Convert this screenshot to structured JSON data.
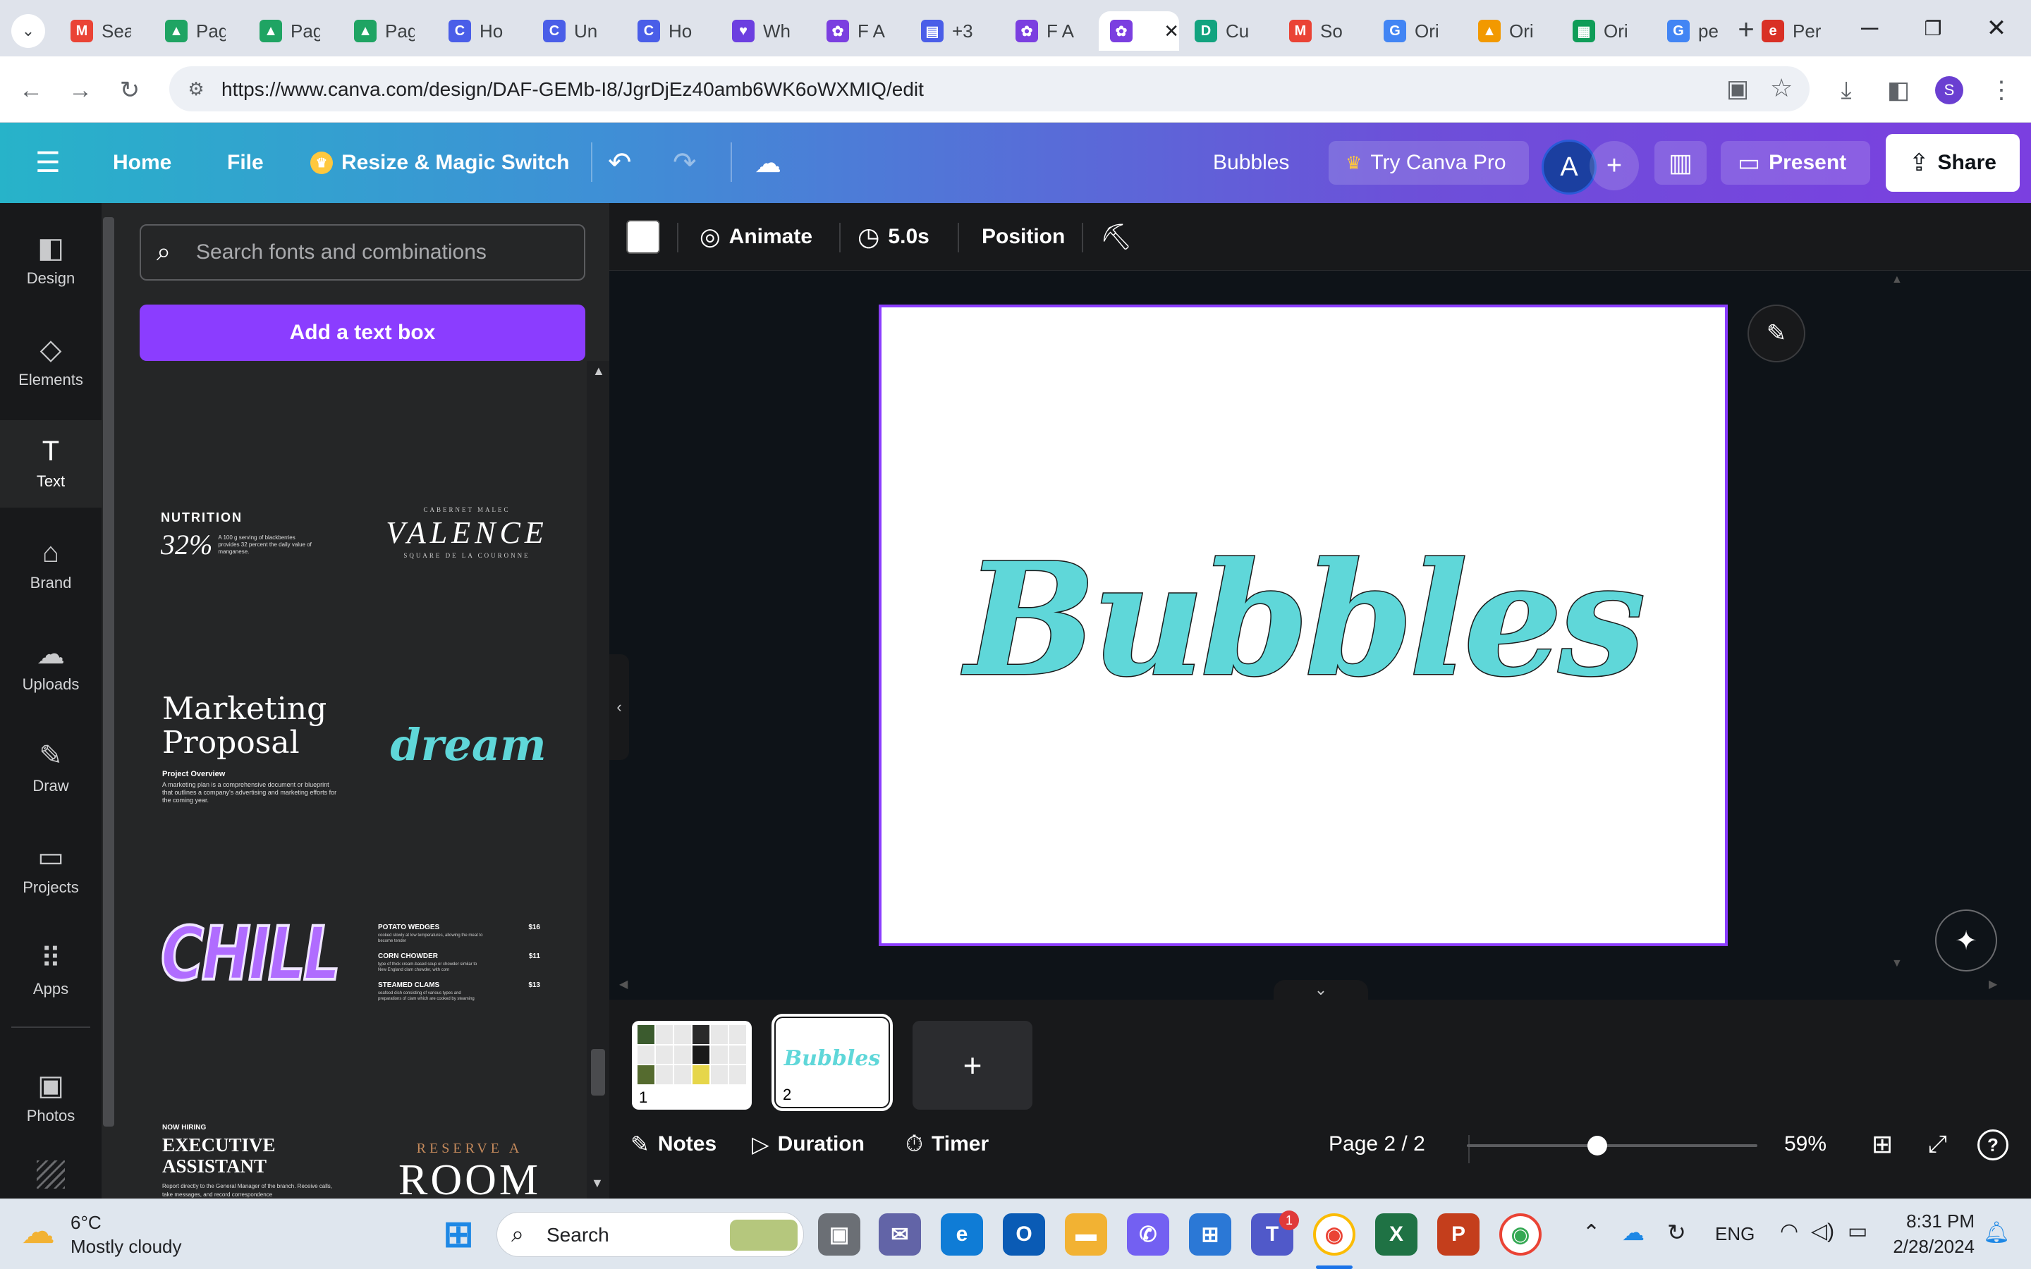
{
  "browser": {
    "tabs": [
      {
        "title": "Sea",
        "icon": "gmail-icon",
        "color": "#ea4335",
        "glyph": "M"
      },
      {
        "title": "Pag",
        "icon": "google-drive-icon",
        "color": "#1fa463",
        "glyph": "▲"
      },
      {
        "title": "Pag",
        "icon": "google-drive-icon",
        "color": "#1fa463",
        "glyph": "▲"
      },
      {
        "title": "Pag",
        "icon": "google-drive-icon",
        "color": "#1fa463",
        "glyph": "▲"
      },
      {
        "title": "Ho",
        "icon": "canva-icon",
        "color": "#4a5ee8",
        "glyph": "C"
      },
      {
        "title": "Un",
        "icon": "canva-icon",
        "color": "#4a5ee8",
        "glyph": "C"
      },
      {
        "title": "Ho",
        "icon": "canva-icon",
        "color": "#4a5ee8",
        "glyph": "C"
      },
      {
        "title": "Wh",
        "icon": "heart-chat-icon",
        "color": "#6c3fe0",
        "glyph": "♥"
      },
      {
        "title": "F A",
        "icon": "canva-presentation-icon",
        "color": "#7b3fe0",
        "glyph": "✿"
      },
      {
        "title": "+3",
        "icon": "print-icon",
        "color": "#4a5ee8",
        "glyph": "▤"
      },
      {
        "title": "F A",
        "icon": "canva-presentation-icon",
        "color": "#7b3fe0",
        "glyph": "✿"
      },
      {
        "title": "",
        "icon": "canva-presentation-icon",
        "color": "#7b3fe0",
        "glyph": "✿",
        "active": true
      },
      {
        "title": "Cu",
        "icon": "docs-icon",
        "color": "#12a37f",
        "glyph": "D"
      },
      {
        "title": "So",
        "icon": "gmail-icon",
        "color": "#ea4335",
        "glyph": "M"
      },
      {
        "title": "Ori",
        "icon": "google-icon",
        "color": "#4285f4",
        "glyph": "G"
      },
      {
        "title": "Ori",
        "icon": "warning-icon",
        "color": "#f29900",
        "glyph": "▲"
      },
      {
        "title": "Ori",
        "icon": "sheets-icon",
        "color": "#0f9d58",
        "glyph": "▦"
      },
      {
        "title": "pe",
        "icon": "google-icon",
        "color": "#4285f4",
        "glyph": "G"
      },
      {
        "title": "Per",
        "icon": "edu-icon",
        "color": "#d93025",
        "glyph": "e"
      }
    ],
    "url": "https://www.canva.com/design/DAF-GEMb-I8/JgrDjEz40amb6WK6oWXMIQ/edit",
    "profile_initial": "S"
  },
  "header": {
    "home": "Home",
    "file": "File",
    "resize": "Resize & Magic Switch",
    "title": "Bubbles",
    "try_pro": "Try Canva Pro",
    "avatar": "A",
    "present": "Present",
    "share": "Share"
  },
  "rail": [
    {
      "label": "Design",
      "icon": "design-icon",
      "glyph": "◧"
    },
    {
      "label": "Elements",
      "icon": "elements-icon",
      "glyph": "◇"
    },
    {
      "label": "Text",
      "icon": "text-icon",
      "glyph": "T",
      "active": true
    },
    {
      "label": "Brand",
      "icon": "brand-icon",
      "glyph": "⌂"
    },
    {
      "label": "Uploads",
      "icon": "uploads-icon",
      "glyph": "☁"
    },
    {
      "label": "Draw",
      "icon": "draw-icon",
      "glyph": "✎"
    },
    {
      "label": "Projects",
      "icon": "folder-icon",
      "glyph": "▭"
    },
    {
      "label": "Apps",
      "icon": "apps-icon",
      "glyph": "⠿"
    },
    {
      "label": "Photos",
      "icon": "photos-icon",
      "glyph": "▣"
    }
  ],
  "panel": {
    "search_placeholder": "Search fonts and combinations",
    "add_text_box": "Add a text box",
    "templates": {
      "nutrition_title": "NUTRITION",
      "nutrition_pct": "32%",
      "nutrition_body": "A 100 g serving of blackberries provides 32 percent the daily value of manganese.",
      "valence_top": "CABERNET MALEC",
      "valence": "VALENCE",
      "valence_bottom": "SQUARE DE LA COURONNE",
      "marketing_title": "Marketing Proposal",
      "marketing_sub": "Project Overview",
      "marketing_body": "A marketing plan is a comprehensive document or blueprint that outlines a company's advertising and marketing efforts for the coming year.",
      "dream": "dream",
      "chill": "CHILL",
      "menu": [
        {
          "item": "POTATO WEDGES",
          "price": "$16",
          "desc": "cooked slowly at low temperatures, allowing the meat to become tender"
        },
        {
          "item": "CORN CHOWDER",
          "price": "$11",
          "desc": "type of thick cream-based soup or chowder similar to New England clam chowder, with corn"
        },
        {
          "item": "STEAMED CLAMS",
          "price": "$13",
          "desc": "seafood dish consisting of various types and preparations of clam which are cooked by steaming"
        }
      ],
      "hiring_top": "NOW HIRING",
      "hiring_title": "EXECUTIVE ASSISTANT",
      "hiring_body": "Report directly to the General Manager of the branch. Receive calls, take messages, and record correspondence",
      "reserve_top": "RESERVE A",
      "reserve_main": "ROOM"
    }
  },
  "toolbar": {
    "animate": "Animate",
    "duration": "5.0s",
    "position": "Position"
  },
  "canvas": {
    "text": "Bubbles",
    "fill_color": "#5fd7d9",
    "outline_color": "#1b1b1b"
  },
  "pages": {
    "thumb1_num": "1",
    "thumb2_num": "2",
    "thumb2_text": "Bubbles"
  },
  "footer": {
    "notes": "Notes",
    "duration": "Duration",
    "timer": "Timer",
    "page": "Page 2 / 2",
    "zoom_pct": "59%",
    "zoom_value": 0.45
  },
  "taskbar": {
    "weather_temp": "6°C",
    "weather_desc": "Mostly cloudy",
    "search": "Search",
    "lang": "ENG",
    "time": "8:31 PM",
    "date": "2/28/2024",
    "teams_badge": "1"
  }
}
